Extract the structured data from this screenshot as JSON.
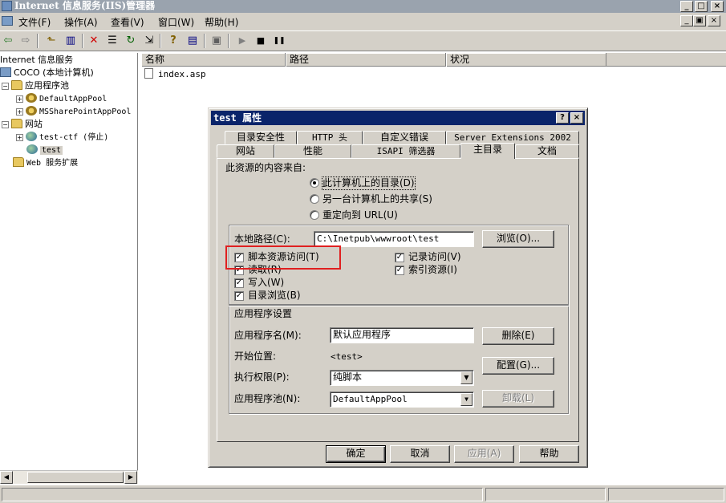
{
  "window": {
    "title": "Internet 信息服务(IIS)管理器",
    "buttons": [
      "_",
      "□",
      "×"
    ]
  },
  "menubar": {
    "items": [
      "文件(F)",
      "操作(A)",
      "查看(V)",
      "窗口(W)",
      "帮助(H)"
    ],
    "mdi_buttons": [
      "_",
      "▣",
      "×"
    ]
  },
  "toolbar": {
    "icons": [
      "back-icon",
      "forward-icon",
      "up-folder-icon",
      "show-tree-icon",
      "delete-icon",
      "properties-icon",
      "refresh-icon",
      "export-icon",
      "help-icon",
      "console-icon",
      "computer-icon",
      "play-icon",
      "stop-icon",
      "pause-icon"
    ],
    "glyphs": [
      "⇦",
      "⇨",
      "⬑",
      "▥",
      "✕",
      "☰",
      "↻",
      "⇲",
      "?",
      "▤",
      "▣",
      "▶",
      "■",
      "❚❚"
    ]
  },
  "tree": {
    "root": "Internet 信息服务",
    "computer": "COCO (本地计算机)",
    "app_pools": "应用程序池",
    "pool_1": "DefaultAppPool",
    "pool_2": "MSSharePointAppPool",
    "websites": "网站",
    "site_1": "test-ctf (停止)",
    "site_2": "test",
    "web_ext": "Web 服务扩展"
  },
  "list": {
    "columns": [
      "名称",
      "路径",
      "状况"
    ],
    "rows": [
      {
        "name": "index.asp"
      }
    ]
  },
  "dialog": {
    "title": "test 属性",
    "help_btn": "?",
    "close_btn": "×",
    "tabs_row1": [
      "目录安全性",
      "HTTP 头",
      "自定义错误",
      "Server Extensions 2002"
    ],
    "tabs_row2": [
      "网站",
      "性能",
      "ISAPI 筛选器",
      "主目录",
      "文档"
    ],
    "active_tab": "主目录",
    "content_source_label": "此资源的内容来自:",
    "radio_options": [
      "此计算机上的目录(D)",
      "另一台计算机上的共享(S)",
      "重定向到 URL(U)"
    ],
    "selected_radio": 0,
    "local_path_label": "本地路径(C):",
    "local_path_value": "C:\\Inetpub\\wwwroot\\test",
    "browse_btn": "浏览(O)...",
    "checkboxes_left": [
      {
        "label": "脚本资源访问(T)",
        "checked": true
      },
      {
        "label": "读取(R)",
        "checked": true
      },
      {
        "label": "写入(W)",
        "checked": true
      },
      {
        "label": "目录浏览(B)",
        "checked": true
      }
    ],
    "checkboxes_right": [
      {
        "label": "记录访问(V)",
        "checked": true
      },
      {
        "label": "索引资源(I)",
        "checked": true
      }
    ],
    "check_mark": "✓",
    "app_settings_label": "应用程序设置",
    "app_name_label": "应用程序名(M):",
    "app_name_value": "默认应用程序",
    "remove_btn": "删除(E)",
    "start_point_label": "开始位置:",
    "start_point_value": "<test>",
    "config_btn": "配置(G)...",
    "exec_perm_label": "执行权限(P):",
    "exec_perm_value": "纯脚本",
    "app_pool_label": "应用程序池(N):",
    "app_pool_value": "DefaultAppPool",
    "unload_btn": "卸载(L)",
    "ok_btn": "确定",
    "cancel_btn": "取消",
    "apply_btn": "应用(A)",
    "help_footer_btn": "帮助"
  },
  "scroll": {
    "left": "◀",
    "right": "▶",
    "dropdown": "▼"
  },
  "colors": {
    "title_active": "#0a246a",
    "highlight_box": "#e02020",
    "face": "#d4d0c8"
  }
}
